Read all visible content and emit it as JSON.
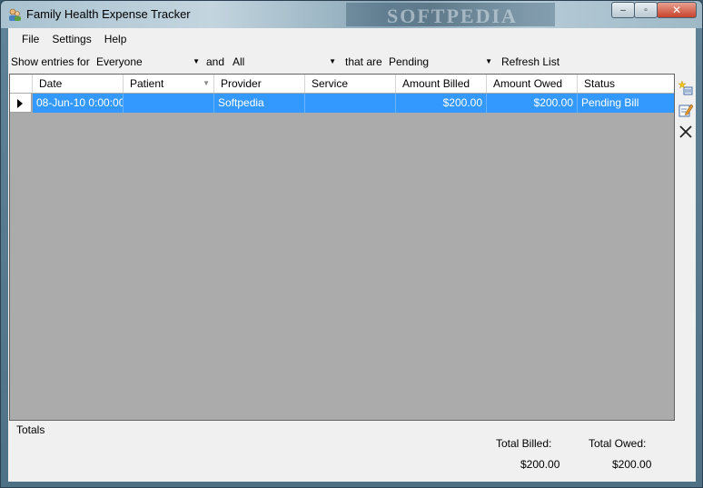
{
  "window": {
    "title": "Family Health Expense Tracker",
    "watermark": "SOFTPEDIA",
    "controls": {
      "minimize": "–",
      "maximize": "▫",
      "close": "✕"
    }
  },
  "menu": {
    "items": [
      "File",
      "Settings",
      "Help"
    ]
  },
  "filters": {
    "show_entries_for_label": "Show entries for",
    "person_value": "Everyone",
    "and_label": "and",
    "category_value": "All",
    "that_are_label": "that are",
    "status_value": "Pending",
    "refresh_label": "Refresh List"
  },
  "grid": {
    "columns": [
      "Date",
      "Patient",
      "Provider",
      "Service",
      "Amount Billed",
      "Amount Owed",
      "Status"
    ],
    "rows": [
      {
        "date": "08-Jun-10 0:00:00",
        "patient": "",
        "provider": "Softpedia",
        "service": "",
        "amount_billed": "$200.00",
        "amount_owed": "$200.00",
        "status": "Pending Bill"
      }
    ],
    "selection_color": "#3399ff",
    "empty_area_color": "#ababab"
  },
  "sidebar": {
    "icons": [
      "add-entry-icon",
      "edit-entry-icon",
      "delete-entry-icon"
    ]
  },
  "totals": {
    "label": "Totals",
    "total_billed_label": "Total Billed:",
    "total_billed_value": "$200.00",
    "total_owed_label": "Total Owed:",
    "total_owed_value": "$200.00"
  }
}
